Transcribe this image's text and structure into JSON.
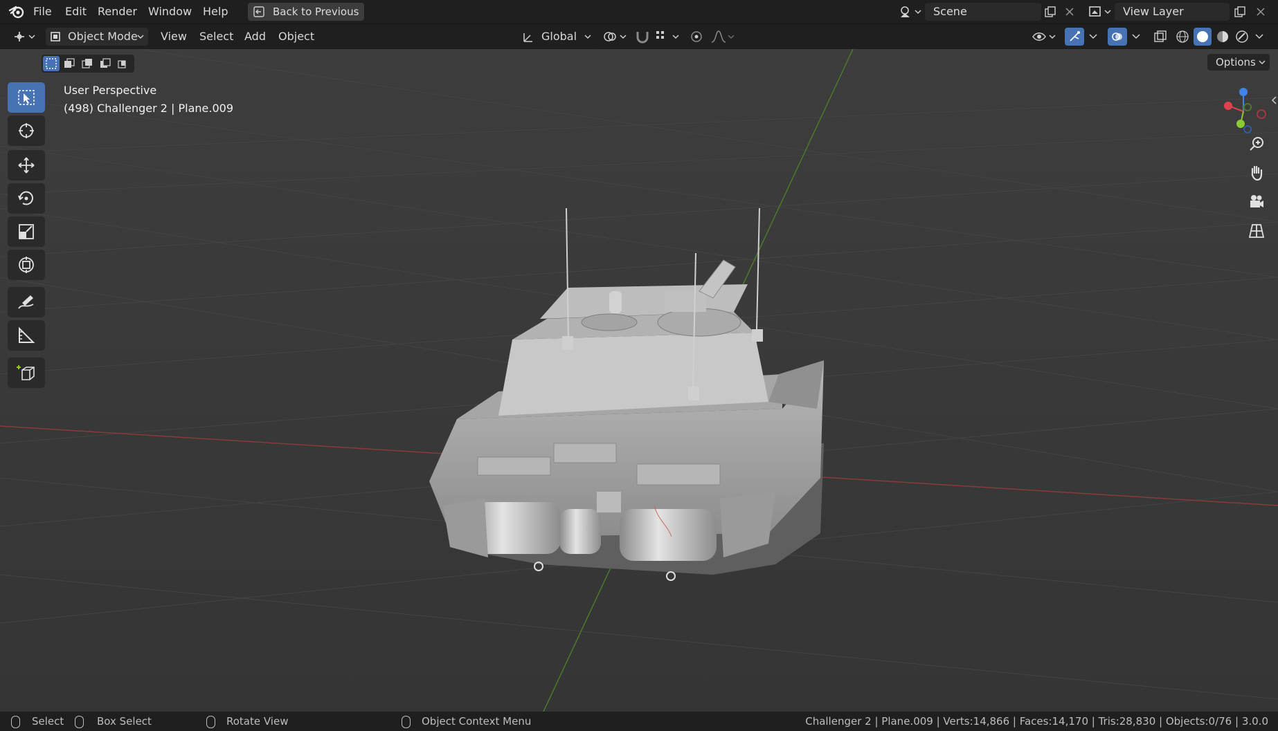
{
  "topbar": {
    "menus": [
      "File",
      "Edit",
      "Render",
      "Window",
      "Help"
    ],
    "back_button": "Back to Previous",
    "scene": "Scene",
    "view_layer": "View Layer"
  },
  "header": {
    "mode": "Object Mode",
    "menus": [
      "View",
      "Select",
      "Add",
      "Object"
    ],
    "transform_orientation": "Global",
    "options_label": "Options"
  },
  "viewport": {
    "perspective_label": "User Perspective",
    "object_info": "(498) Challenger 2 | Plane.009"
  },
  "tools": [
    "select-box-tool",
    "cursor-tool",
    "move-tool",
    "rotate-tool",
    "scale-tool",
    "transform-tool",
    "annotate-tool",
    "measure-tool",
    "add-cube-tool"
  ],
  "statusbar": {
    "select": "Select",
    "box_select": "Box Select",
    "rotate_view": "Rotate View",
    "context_menu": "Object Context Menu",
    "stats": "Challenger 2 | Plane.009 | Verts:14,866 | Faces:14,170 | Tris:28,830 | Objects:0/76 | 3.0.0"
  },
  "colors": {
    "accent": "#4772b3",
    "x_axis": "#e0424d",
    "y_axis": "#8bcb2f",
    "z_axis": "#3f84e6"
  }
}
